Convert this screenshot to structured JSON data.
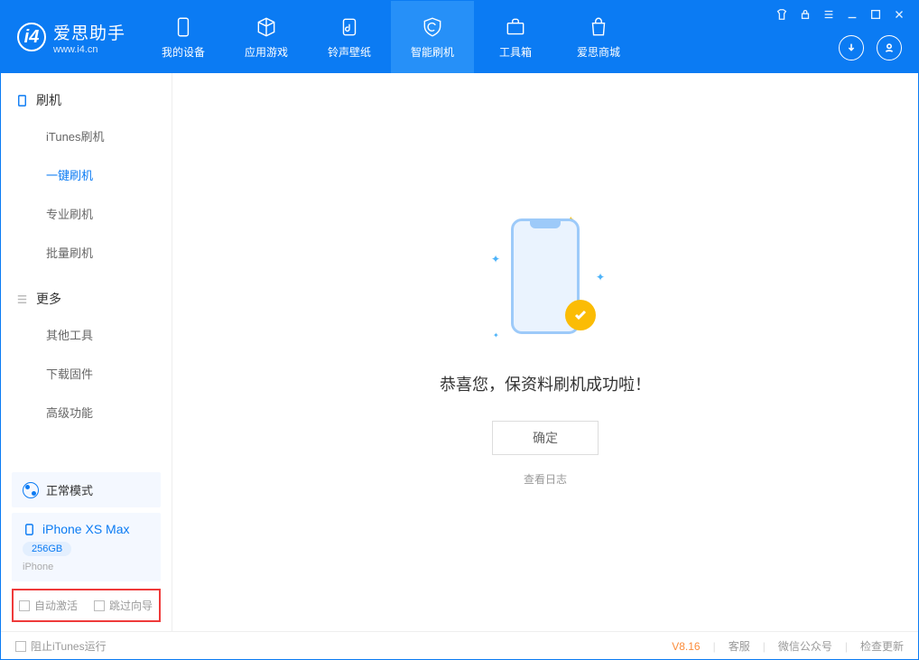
{
  "app": {
    "name": "爱思助手",
    "url": "www.i4.cn"
  },
  "nav": {
    "items": [
      {
        "label": "我的设备"
      },
      {
        "label": "应用游戏"
      },
      {
        "label": "铃声壁纸"
      },
      {
        "label": "智能刷机"
      },
      {
        "label": "工具箱"
      },
      {
        "label": "爱思商城"
      }
    ],
    "active_index": 3
  },
  "sidebar": {
    "groups": [
      {
        "title": "刷机",
        "items": [
          {
            "label": "iTunes刷机"
          },
          {
            "label": "一键刷机"
          },
          {
            "label": "专业刷机"
          },
          {
            "label": "批量刷机"
          }
        ],
        "active_index": 1
      },
      {
        "title": "更多",
        "items": [
          {
            "label": "其他工具"
          },
          {
            "label": "下载固件"
          },
          {
            "label": "高级功能"
          }
        ]
      }
    ],
    "mode": "正常模式",
    "device": {
      "name": "iPhone XS Max",
      "capacity": "256GB",
      "type": "iPhone"
    },
    "options": {
      "auto_activate": "自动激活",
      "skip_guide": "跳过向导"
    }
  },
  "main": {
    "success_text": "恭喜您，保资料刷机成功啦！",
    "ok_button": "确定",
    "view_log": "查看日志"
  },
  "footer": {
    "block_itunes": "阻止iTunes运行",
    "version": "V8.16",
    "links": {
      "service": "客服",
      "wechat": "微信公众号",
      "update": "检查更新"
    }
  }
}
